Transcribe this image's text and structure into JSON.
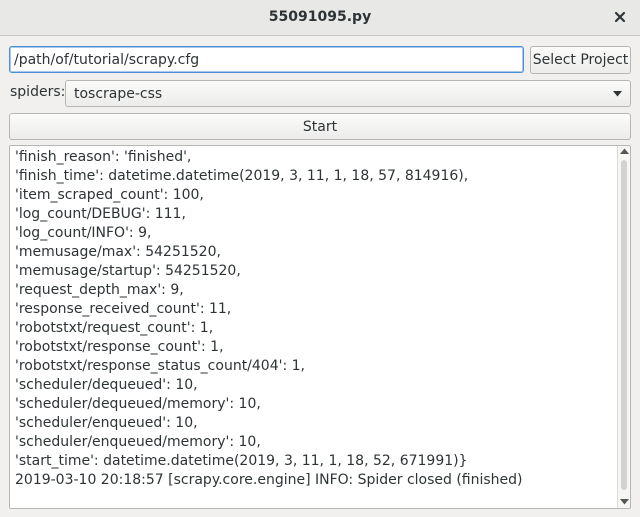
{
  "window": {
    "title": "55091095.py"
  },
  "project": {
    "path_value": "/path/of/tutorial/scrapy.cfg",
    "select_label": "Select Project"
  },
  "spiders": {
    "label": "spiders:",
    "selected": "toscrape-css"
  },
  "start_label": "Start",
  "log": {
    "lines": [
      "'finish_reason': 'finished',",
      "'finish_time': datetime.datetime(2019, 3, 11, 1, 18, 57, 814916),",
      "'item_scraped_count': 100,",
      "'log_count/DEBUG': 111,",
      "'log_count/INFO': 9,",
      "'memusage/max': 54251520,",
      "'memusage/startup': 54251520,",
      "'request_depth_max': 9,",
      "'response_received_count': 11,",
      "'robotstxt/request_count': 1,",
      "'robotstxt/response_count': 1,",
      "'robotstxt/response_status_count/404': 1,",
      "'scheduler/dequeued': 10,",
      "'scheduler/dequeued/memory': 10,",
      "'scheduler/enqueued': 10,",
      "'scheduler/enqueued/memory': 10,",
      "'start_time': datetime.datetime(2019, 3, 11, 1, 18, 52, 671991)}",
      "2019-03-10 20:18:57 [scrapy.core.engine] INFO: Spider closed (finished)"
    ]
  },
  "icons": {
    "close": "close-icon",
    "combo": "chevron-down-icon",
    "scroll_up": "triangle-up-icon",
    "scroll_down": "triangle-down-icon"
  }
}
